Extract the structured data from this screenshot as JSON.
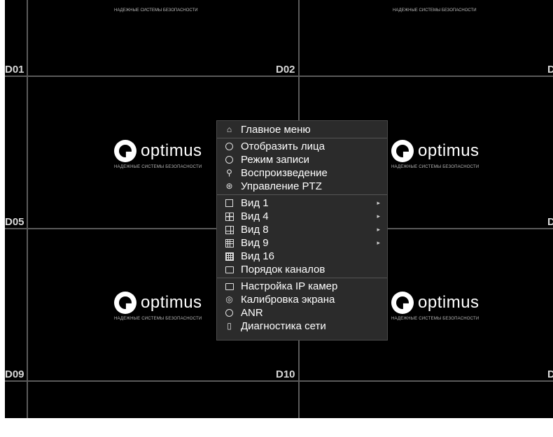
{
  "channels": {
    "d01": "D01",
    "d02": "D02",
    "d05": "D05",
    "d09": "D09",
    "d10": "D10",
    "edge": "D"
  },
  "logo": {
    "name": "optimus",
    "tagline": "НАДЕЖНЫЕ СИСТЕМЫ БЕЗОПАСНОСТИ"
  },
  "menu": {
    "items": [
      {
        "icon": "home-icon",
        "label": "Главное меню"
      },
      {
        "icon": "face-detect-icon",
        "label": "Отобразить лица"
      },
      {
        "icon": "record-mode-icon",
        "label": "Режим записи"
      },
      {
        "icon": "search-icon",
        "label": "Воспроизведение"
      },
      {
        "icon": "ptz-icon",
        "label": "Управление PTZ"
      },
      {
        "icon": "view1-icon",
        "label": "Вид 1",
        "submenu": true
      },
      {
        "icon": "view4-icon",
        "label": "Вид 4",
        "submenu": true
      },
      {
        "icon": "view8-icon",
        "label": "Вид 8",
        "submenu": true
      },
      {
        "icon": "view9-icon",
        "label": "Вид 9",
        "submenu": true
      },
      {
        "icon": "view16-icon",
        "label": "Вид 16"
      },
      {
        "icon": "channel-order-icon",
        "label": "Порядок каналов"
      },
      {
        "icon": "ip-camera-icon",
        "label": "Настройка IP камер"
      },
      {
        "icon": "calibration-icon",
        "label": "Калибровка экрана"
      },
      {
        "icon": "anr-icon",
        "label": "ANR"
      },
      {
        "icon": "network-icon",
        "label": "Диагностика сети"
      }
    ],
    "arrow": "▸"
  },
  "colors": {
    "background": "#000000",
    "grid_line": "#5a5a5a",
    "menu_bg": "#2b2b2b"
  }
}
